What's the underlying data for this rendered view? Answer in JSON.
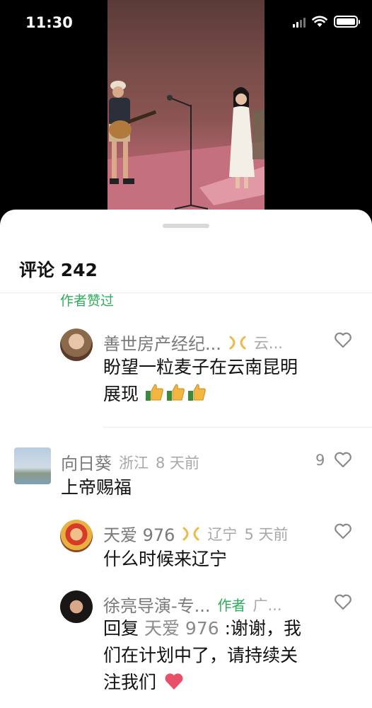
{
  "status_bar": {
    "time": "11:30"
  },
  "comments_header": {
    "label": "评论",
    "count": "242"
  },
  "author_liked": "作者赞过",
  "comments": [
    {
      "name": "善世房产经纪...",
      "location": "云...",
      "text_line1": "盼望一粒麦子在云南昆明",
      "text_line2": "展现",
      "text_emoji": "thumbs-up"
    },
    {
      "name": "向日葵",
      "location": "浙江",
      "time": "8 天前",
      "likes": "9",
      "text": "上帝赐福"
    },
    {
      "name": "天爱 976",
      "location": "辽宁",
      "time": "5 天前",
      "text": "什么时候来辽宁"
    },
    {
      "name": "徐亮导演-专...",
      "author_tag": "作者",
      "location": "广...",
      "reply_prefix": "回复",
      "reply_to": "天爱 976",
      "text_line1": ":谢谢，我",
      "text_line2": "们在计划中了，请持续关",
      "text_line3": "注我们",
      "text_emoji": "heart"
    }
  ],
  "colors": {
    "green": "#2dae5a",
    "sheet_bg": "#ffffff",
    "fan_badge": "#f0b84a",
    "heart": "#e8506a"
  }
}
